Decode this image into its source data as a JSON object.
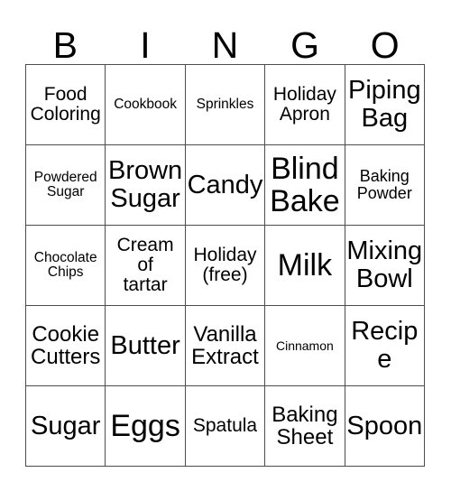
{
  "card": {
    "title_letters": [
      "B",
      "I",
      "N",
      "G",
      "O"
    ],
    "free_space_index": 12,
    "colors": {
      "background": "#ffffff",
      "text": "#000000",
      "grid_line": "#4d4d4d"
    },
    "cells": [
      {
        "label": "Food\nColoring",
        "size": "fs-l"
      },
      {
        "label": "Cookbook",
        "size": "fs-s"
      },
      {
        "label": "Sprinkles",
        "size": "fs-s"
      },
      {
        "label": "Holiday\nApron",
        "size": "fs-l"
      },
      {
        "label": "Piping\nBag",
        "size": "fs-xxl"
      },
      {
        "label": "Powdered\nSugar",
        "size": "fs-s"
      },
      {
        "label": "Brown\nSugar",
        "size": "fs-xxl"
      },
      {
        "label": "Candy",
        "size": "fs-xxl"
      },
      {
        "label": "Blind\nBake",
        "size": "fs-huge"
      },
      {
        "label": "Baking\nPowder",
        "size": "fs-m"
      },
      {
        "label": "Chocolate\nChips",
        "size": "fs-s"
      },
      {
        "label": "Cream\nof\ntartar",
        "size": "fs-l"
      },
      {
        "label": "Holiday\n(free)",
        "size": "fs-l"
      },
      {
        "label": "Milk",
        "size": "fs-huge"
      },
      {
        "label": "Mixing\nBowl",
        "size": "fs-xxl"
      },
      {
        "label": "Cookie\nCutters",
        "size": "fs-xl"
      },
      {
        "label": "Butter",
        "size": "fs-xxl"
      },
      {
        "label": "Vanilla\nExtract",
        "size": "fs-xl"
      },
      {
        "label": "Cinnamon",
        "size": "fs-xs"
      },
      {
        "label": "Recipe",
        "size": "fs-xxl"
      },
      {
        "label": "Sugar",
        "size": "fs-xxl"
      },
      {
        "label": "Eggs",
        "size": "fs-huge"
      },
      {
        "label": "Spatula",
        "size": "fs-l"
      },
      {
        "label": "Baking\nSheet",
        "size": "fs-xl"
      },
      {
        "label": "Spoon",
        "size": "fs-xxl"
      }
    ]
  }
}
